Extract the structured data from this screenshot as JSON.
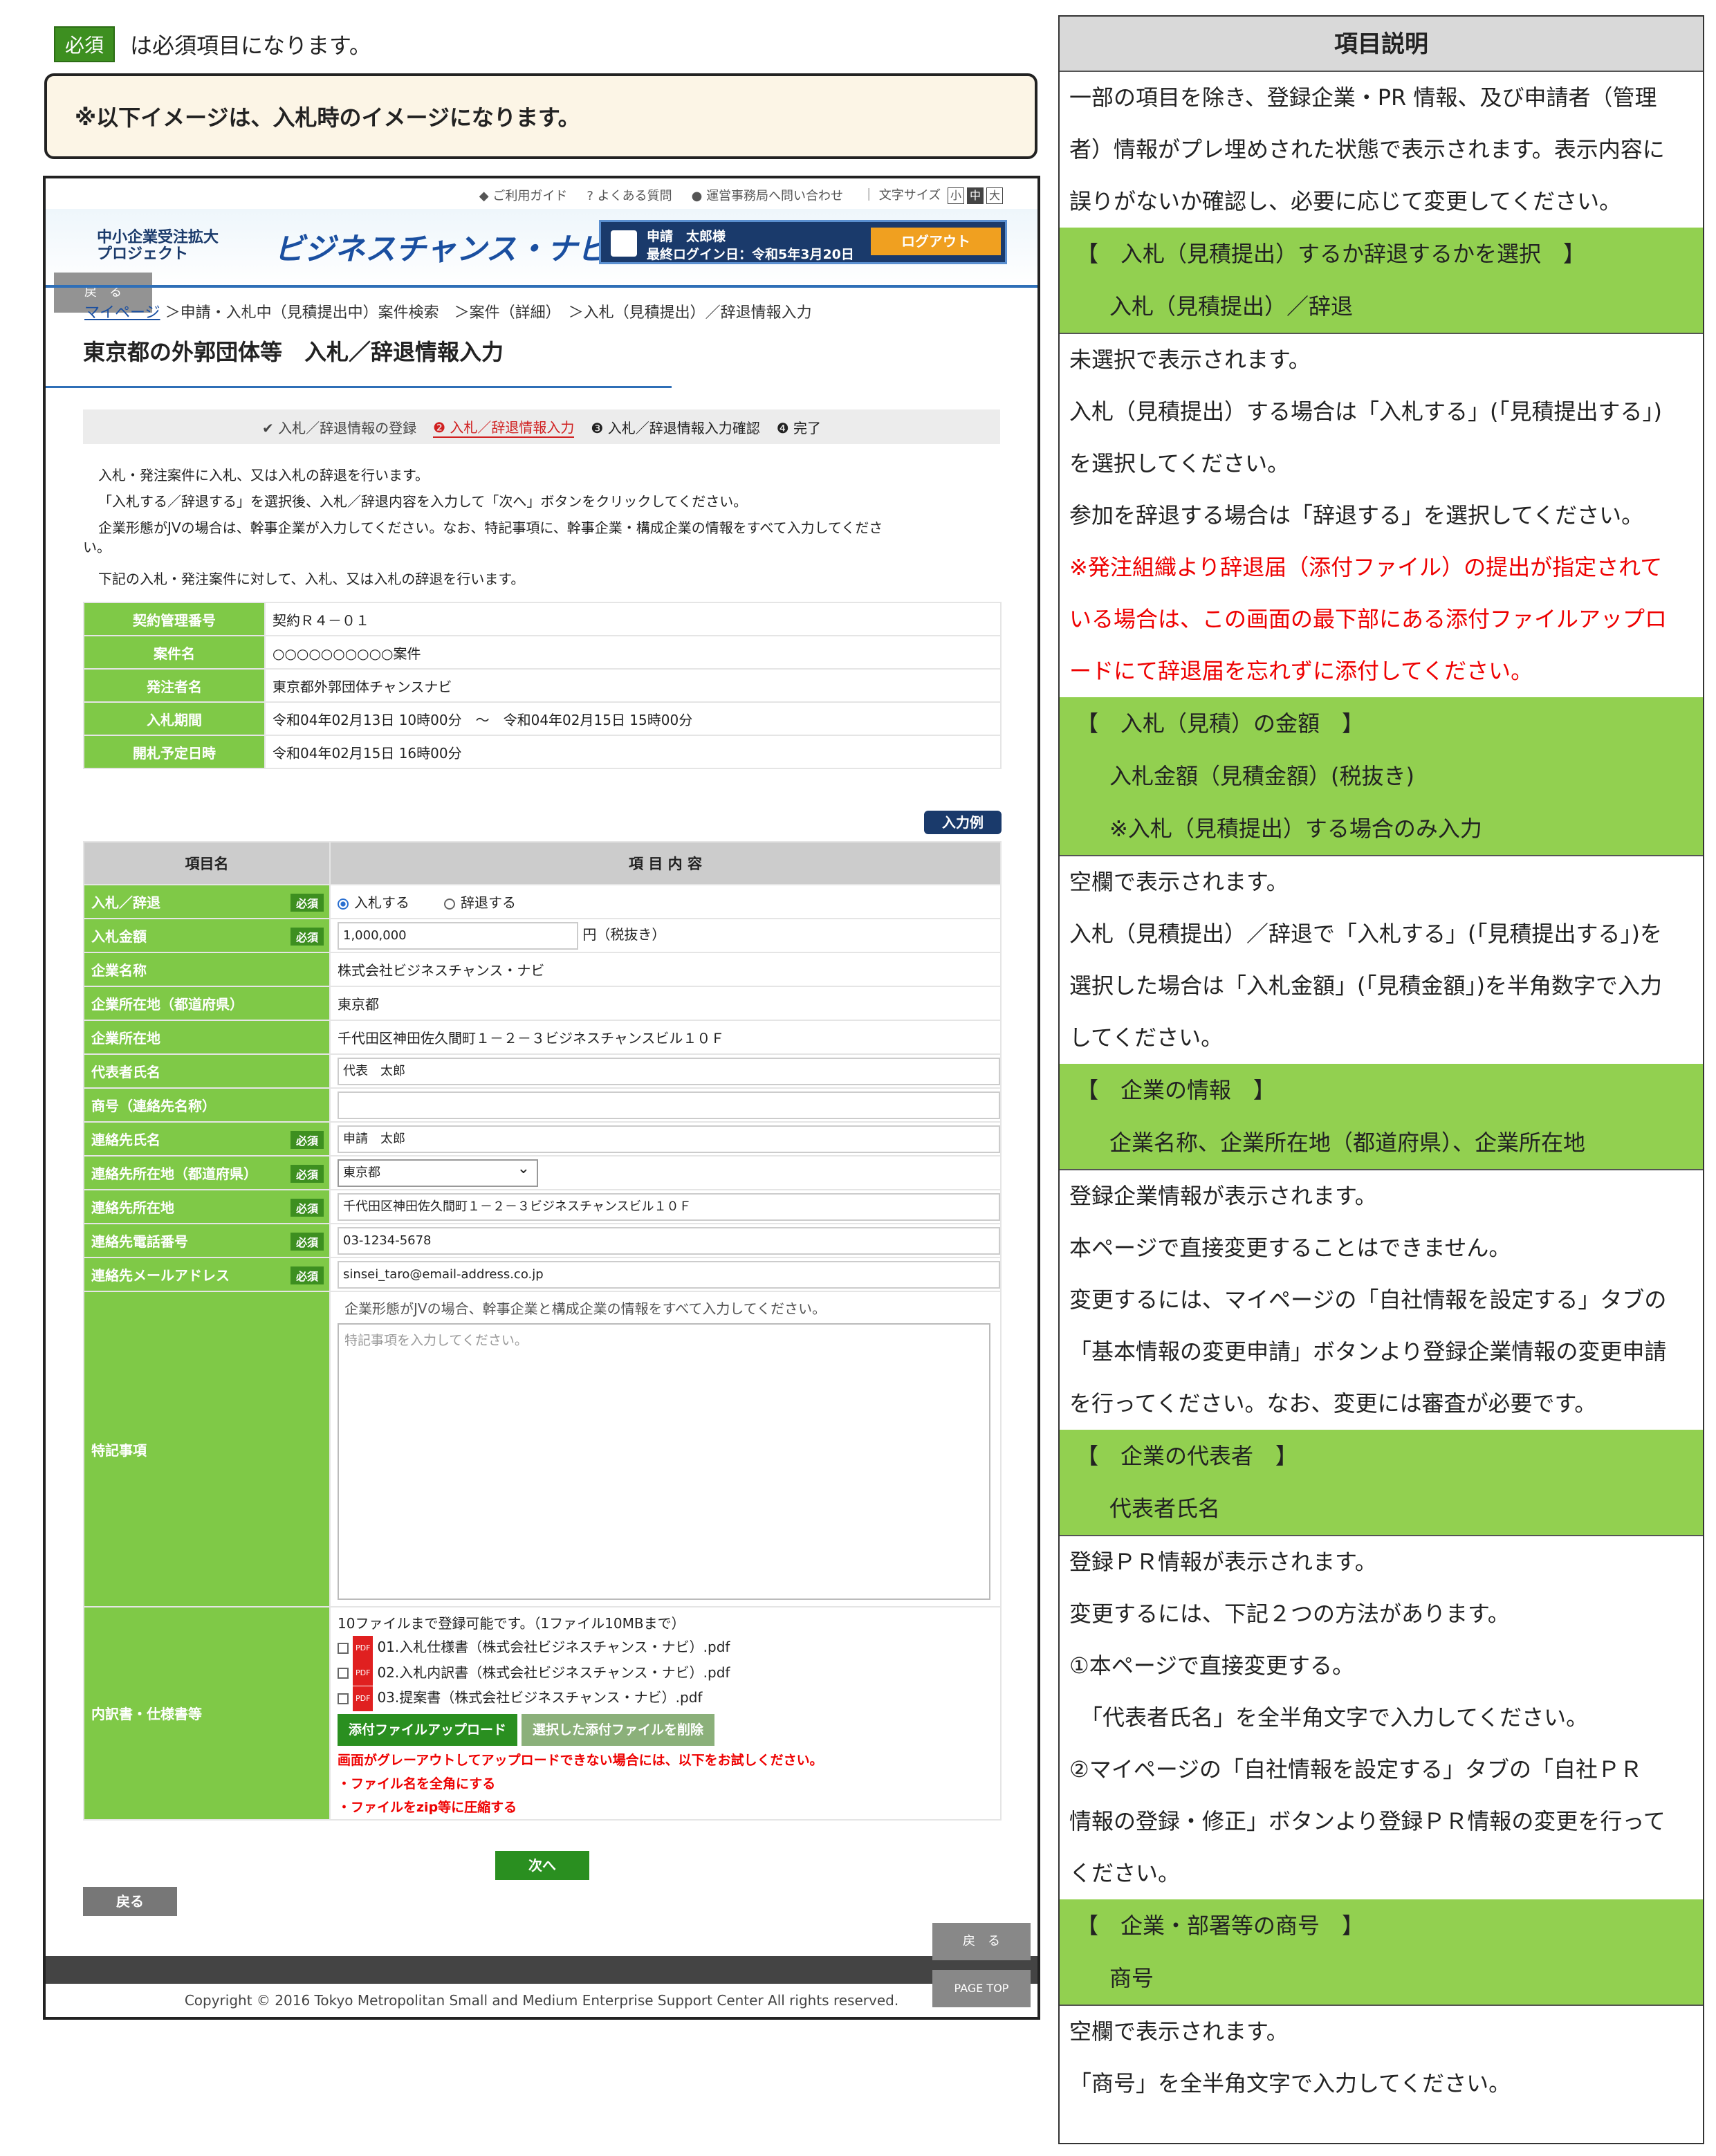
{
  "legend": {
    "required_badge": "必須",
    "text": "は必須項目になります。"
  },
  "note": "※以下イメージは、入札時のイメージになります。",
  "screen": {
    "util": {
      "guide": "ご利用ガイド",
      "faq": "よくある質問",
      "contact": "運営事務局へ問い合わせ",
      "font_size": "文字サイズ",
      "sizes": [
        "小",
        "中",
        "大"
      ]
    },
    "logo": {
      "line1": "中小企業受注拡大",
      "line2": "プロジェクト",
      "brand": "ビジネスチャンス・ナビ"
    },
    "user": {
      "name": "申請　太郎様",
      "last_login": "最終ログイン日：令和5年3月20日",
      "logout": "ログアウト"
    },
    "back_label": "戻　る",
    "breadcrumb": {
      "home": "マイページ",
      "rest": "＞申請・入札中（見積提出中）案件検索　＞案件（詳細）　＞入札（見積提出）／辞退情報入力"
    },
    "page_title": "東京都の外郭団体等　入札／辞退情報入力",
    "steps": [
      {
        "label": "✔ 入札／辞退情報の登録"
      },
      {
        "label": "❷ 入札／辞退情報入力"
      },
      {
        "label": "❸ 入札／辞退情報入力確認"
      },
      {
        "label": "❹ 完了"
      }
    ],
    "intro": [
      "入札・発注案件に入札、又は入札の辞退を行います。",
      "「入札する／辞退する」を選択後、入札／辞退内容を入力して「次へ」ボタンをクリックしてください。",
      "企業形態がJVの場合は、幹事企業が入力してください。なお、特記事項に、幹事企業・構成企業の情報をすべて入力してくださ",
      "い。",
      "下記の入札・発注案件に対して、入札、又は入札の辞退を行います。"
    ],
    "info": [
      {
        "label": "契約管理番号",
        "value": "契約Ｒ４－０１"
      },
      {
        "label": "案件名",
        "value": "○○○○○○○○○○案件"
      },
      {
        "label": "発注者名",
        "value": "東京都外郭団体チャンスナビ"
      },
      {
        "label": "入札期間",
        "value": "令和04年02月13日 10時00分　～　令和04年02月15日 15時00分"
      },
      {
        "label": "開札予定日時",
        "value": "令和04年02月15日 16時00分"
      }
    ],
    "example_btn": "入力例",
    "form": {
      "col1": "項目名",
      "col2": "項 目 内 容",
      "bid_label": "入札／辞退",
      "bid_opt1": "入札する",
      "bid_opt2": "辞退する",
      "amount_label": "入札金額",
      "amount_value": "1,000,000",
      "amount_unit": "円（税抜き）",
      "company_label": "企業名称",
      "company_value": "株式会社ビジネスチャンス・ナビ",
      "pref_label": "企業所在地（都道府県）",
      "pref_value": "東京都",
      "addr_label": "企業所在地",
      "addr_value": "千代田区神田佐久間町１－２－３ビジネスチャンスビル１０Ｆ",
      "rep_label": "代表者氏名",
      "rep_value": "代表　太郎",
      "trade_label": "商号（連絡先名称）",
      "trade_value": "",
      "cname_label": "連絡先氏名",
      "cname_value": "申請　太郎",
      "cpref_label": "連絡先所在地（都道府県）",
      "cpref_value": "東京都",
      "caddr_label": "連絡先所在地",
      "caddr_value": "千代田区神田佐久間町１－２－３ビジネスチャンスビル１０Ｆ",
      "tel_label": "連絡先電話番号",
      "tel_value": "03-1234-5678",
      "mail_label": "連絡先メールアドレス",
      "mail_value": "sinsei_taro@email-address.co.jp",
      "notes_label": "特記事項",
      "notes_hint": "企業形態がJVの場合、幹事企業と構成企業の情報をすべて入力してください。",
      "notes_placeholder": "特記事項を入力してください。",
      "files_label": "内訳書・仕様書等",
      "files_limit": "10ファイルまで登録可能です。（1ファイル10MBまで）",
      "files": [
        "01.入札仕様書（株式会社ビジネスチャンス・ナビ）.pdf",
        "02.入札内訳書（株式会社ビジネスチャンス・ナビ）.pdf",
        "03.提案書（株式会社ビジネスチャンス・ナビ）.pdf"
      ],
      "upload_btn": "添付ファイルアップロード",
      "delete_btn": "選択した添付ファイルを削除",
      "warn1": "画面がグレーアウトしてアップロードできない場合には、以下をお試しください。",
      "warn2": "・ファイル名を全角にする",
      "warn3": "・ファイルをzip等に圧縮する"
    },
    "next_btn": "次へ",
    "back_btn": "戻る",
    "page_top": "PAGE TOP",
    "copyright": "Copyright © 2016 Tokyo Metropolitan Small and Medium Enterprise Support Center All rights reserved."
  },
  "explain": {
    "title": "項目説明",
    "intro": [
      "一部の項目を除き、登録企業・PR 情報、及び申請者（管理",
      "者）情報がプレ埋めされた状態で表示されます。表示内容に",
      "誤りがないか確認し、必要に応じて変更してください。"
    ],
    "s1_h": "【　入札（見積提出）するか辞退するかを選択　】",
    "s1_sub": "入札（見積提出）／辞退",
    "s1_t": [
      "未選択で表示されます。",
      "入札（見積提出）する場合は「入札する」(「見積提出する」)",
      "を選択してください。",
      "参加を辞退する場合は「辞退する」を選択してください。"
    ],
    "s1_red": [
      "※発注組織より辞退届（添付ファイル）の提出が指定されて",
      "いる場合は、この画面の最下部にある添付ファイルアップロ",
      "ードにて辞退届を忘れずに添付してください。"
    ],
    "s2_h": "【　入札（見積）の金額　】",
    "s2_sub1": "入札金額（見積金額）(税抜き)",
    "s2_sub2": "※入札（見積提出）する場合のみ入力",
    "s2_t": [
      "空欄で表示されます。",
      "入札（見積提出）／辞退で「入札する」(「見積提出する」)を",
      "選択した場合は「入札金額」(「見積金額」)を半角数字で入力",
      "してください。"
    ],
    "s3_h": "【　企業の情報　】",
    "s3_sub": "企業名称、企業所在地（都道府県）、企業所在地",
    "s3_t": [
      "登録企業情報が表示されます。",
      "本ページで直接変更することはできません。",
      "変更するには、マイページの「自社情報を設定する」タブの",
      "「基本情報の変更申請」ボタンより登録企業情報の変更申請",
      "を行ってください。なお、変更には審査が必要です。"
    ],
    "s4_h": "【　企業の代表者　】",
    "s4_sub": "代表者氏名",
    "s4_t": [
      "登録ＰＲ情報が表示されます。",
      "変更するには、下記２つの方法があります。",
      "①本ページで直接変更する。",
      "　「代表者氏名」を全半角文字で入力してください。",
      "②マイページの「自社情報を設定する」タブの「自社ＰＲ",
      "情報の登録・修正」ボタンより登録ＰＲ情報の変更を行って",
      "ください。"
    ],
    "s5_h": "【　企業・部署等の商号　】",
    "s5_sub": "商号",
    "s5_t": [
      "空欄で表示されます。",
      "「商号」を全半角文字で入力してください。"
    ]
  }
}
